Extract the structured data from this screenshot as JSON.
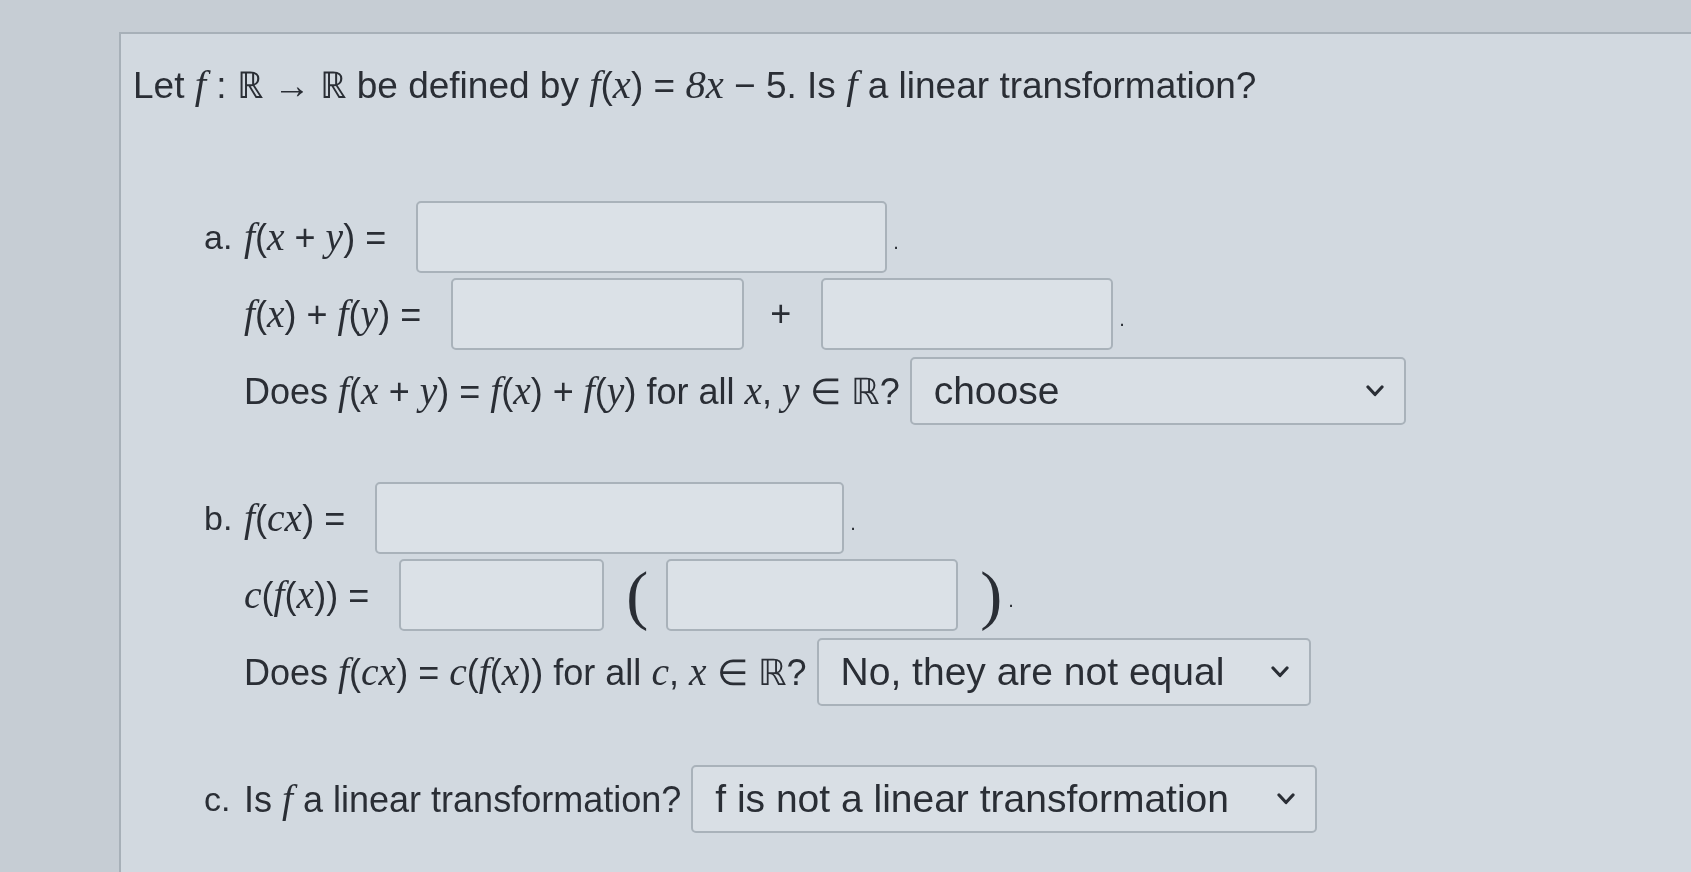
{
  "question": "Let *f* : ℝ → ℝ be defined by *f*(*x*) = *8x* − 5. Is *f* a linear transformation?",
  "parts": [
    {
      "label": "a.",
      "rows": [
        {
          "items": [
            {
              "kind": "text",
              "text": "*f*(*x* + *y*) ="
            },
            {
              "kind": "input"
            },
            {
              "kind": "punct",
              "text": "."
            }
          ]
        },
        {
          "items": [
            {
              "kind": "text",
              "text": "*f*(*x*) + *f*(*y*) ="
            },
            {
              "kind": "input"
            },
            {
              "kind": "text",
              "text": "+"
            },
            {
              "kind": "input"
            },
            {
              "kind": "punct",
              "text": "."
            }
          ]
        },
        {
          "items": [
            {
              "kind": "text",
              "text": "Does *f*(*x* + *y*) = *f*(*x*) + *f*(*y*) for all *x*, *y* ∈ ℝ?"
            },
            {
              "kind": "select",
              "value": "choose"
            }
          ]
        }
      ]
    },
    {
      "label": "b.",
      "rows": [
        {
          "items": [
            {
              "kind": "text",
              "text": "*f*(*cx*) ="
            },
            {
              "kind": "input"
            },
            {
              "kind": "punct",
              "text": "."
            }
          ]
        },
        {
          "items": [
            {
              "kind": "text",
              "text": "*c*(*f*(*x*)) ="
            },
            {
              "kind": "input"
            },
            {
              "kind": "paren",
              "text": "("
            },
            {
              "kind": "input"
            },
            {
              "kind": "paren",
              "text": ")"
            },
            {
              "kind": "punct",
              "text": "."
            }
          ]
        },
        {
          "items": [
            {
              "kind": "text",
              "text": "Does *f*(*cx*) = *c*(*f*(*x*)) for all *c*, *x* ∈ ℝ?"
            },
            {
              "kind": "select",
              "value": "No, they are not equal"
            }
          ]
        }
      ]
    },
    {
      "label": "c.",
      "rows": [
        {
          "items": [
            {
              "kind": "text",
              "text": "Is *f* a linear transformation?"
            },
            {
              "kind": "select",
              "value": "f is not a linear transformation"
            }
          ]
        }
      ]
    }
  ]
}
